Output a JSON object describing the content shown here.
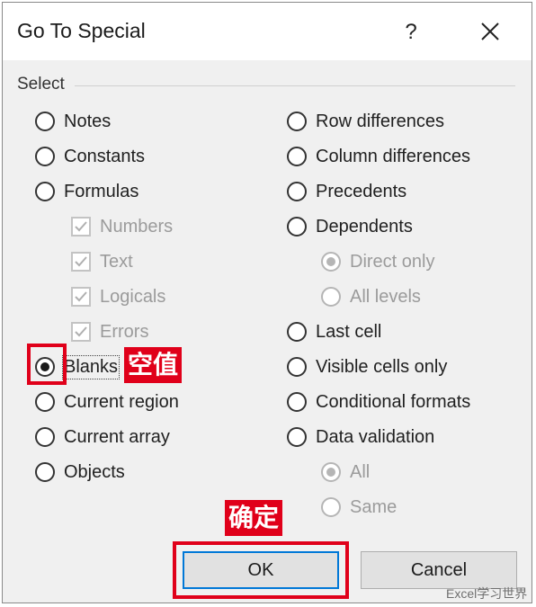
{
  "dialog": {
    "title": "Go To Special",
    "help_label": "?",
    "group_label": "Select"
  },
  "left_options": [
    {
      "label": "Notes",
      "selected": false
    },
    {
      "label": "Constants",
      "selected": false
    },
    {
      "label": "Formulas",
      "selected": false
    },
    {
      "label": "Blanks",
      "selected": true
    },
    {
      "label": "Current region",
      "selected": false
    },
    {
      "label": "Current array",
      "selected": false
    },
    {
      "label": "Objects",
      "selected": false
    }
  ],
  "formula_subs": [
    {
      "label": "Numbers",
      "checked": true,
      "enabled": false
    },
    {
      "label": "Text",
      "checked": true,
      "enabled": false
    },
    {
      "label": "Logicals",
      "checked": true,
      "enabled": false
    },
    {
      "label": "Errors",
      "checked": true,
      "enabled": false
    }
  ],
  "right_options": [
    {
      "label": "Row differences",
      "selected": false
    },
    {
      "label": "Column differences",
      "selected": false
    },
    {
      "label": "Precedents",
      "selected": false
    },
    {
      "label": "Dependents",
      "selected": false
    },
    {
      "label": "Last cell",
      "selected": false
    },
    {
      "label": "Visible cells only",
      "selected": false
    },
    {
      "label": "Conditional formats",
      "selected": false
    },
    {
      "label": "Data validation",
      "selected": false
    }
  ],
  "dependents_subs": [
    {
      "label": "Direct only",
      "selected": true,
      "enabled": false
    },
    {
      "label": "All levels",
      "selected": false,
      "enabled": false
    }
  ],
  "validation_subs": [
    {
      "label": "All",
      "selected": true,
      "enabled": false
    },
    {
      "label": "Same",
      "selected": false,
      "enabled": false
    }
  ],
  "buttons": {
    "ok": "OK",
    "cancel": "Cancel"
  },
  "annotations": {
    "blanks_note": "空值",
    "ok_note": "确定",
    "highlight_color": "#e0001a"
  },
  "watermark": "Excel学习世界"
}
